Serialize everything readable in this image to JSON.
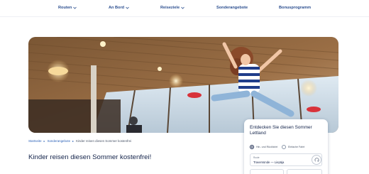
{
  "nav": {
    "items": [
      {
        "label": "Routen",
        "has_dropdown": true
      },
      {
        "label": "An Bord",
        "has_dropdown": true
      },
      {
        "label": "Reiseziele",
        "has_dropdown": true
      },
      {
        "label": "Sonderangebote",
        "has_dropdown": false
      },
      {
        "label": "Bonusprogramm",
        "has_dropdown": false
      }
    ]
  },
  "breadcrumb": {
    "items": [
      {
        "label": "Startseite"
      },
      {
        "label": "Sonderangebote"
      },
      {
        "label": "Kinder reisen diesen Sommer kostenfrei"
      }
    ]
  },
  "page": {
    "title": "Kinder reisen diesen Sommer kostenfrei!"
  },
  "widget": {
    "title": "Entdecken Sie diesen Sommer Lettland",
    "trip_types": [
      {
        "label": "Hin- und Rückfahrt",
        "selected": true
      },
      {
        "label": "Einfache Fahrt",
        "selected": false
      }
    ],
    "route": {
      "label": "Route",
      "value": "Travemünde — Liepāja"
    }
  },
  "colors": {
    "nav_text": "#2b4e8f",
    "link": "#2c62b8",
    "heading": "#13234a"
  }
}
